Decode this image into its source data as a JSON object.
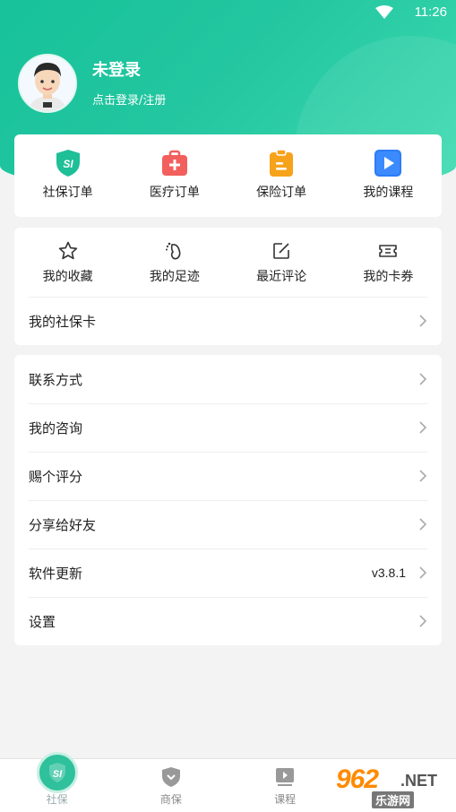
{
  "status_bar": {
    "time": "11:26"
  },
  "profile": {
    "username": "未登录",
    "login_hint": "点击登录/注册"
  },
  "orders": [
    {
      "label": "社保订单",
      "icon": "si-shield-icon",
      "color": "#1fbf98"
    },
    {
      "label": "医疗订单",
      "icon": "medical-kit-icon",
      "color": "#f25f5c"
    },
    {
      "label": "保险订单",
      "icon": "clipboard-icon",
      "color": "#f7a21b"
    },
    {
      "label": "我的课程",
      "icon": "play-icon",
      "color": "#2d7cf6"
    }
  ],
  "tools": [
    {
      "label": "我的收藏",
      "icon": "star-icon"
    },
    {
      "label": "我的足迹",
      "icon": "footprint-icon"
    },
    {
      "label": "最近评论",
      "icon": "edit-icon"
    },
    {
      "label": "我的卡券",
      "icon": "ticket-icon"
    }
  ],
  "social_card": {
    "label": "我的社保卡"
  },
  "menu": [
    {
      "label": "联系方式",
      "value": ""
    },
    {
      "label": "我的咨询",
      "value": ""
    },
    {
      "label": "赐个评分",
      "value": ""
    },
    {
      "label": "分享给好友",
      "value": ""
    },
    {
      "label": "软件更新",
      "value": "v3.8.1"
    },
    {
      "label": "设置",
      "value": ""
    }
  ],
  "tabbar": [
    {
      "label": "社保",
      "icon": "si-badge-icon",
      "active": true
    },
    {
      "label": "商保",
      "icon": "shield-icon",
      "active": false
    },
    {
      "label": "课程",
      "icon": "video-icon",
      "active": false
    }
  ],
  "watermark": {
    "number": "962",
    "suffix": ".NET",
    "subtitle": "乐游网"
  },
  "colors": {
    "brand_green": "#1fc29b",
    "background": "#f3f3f3"
  }
}
